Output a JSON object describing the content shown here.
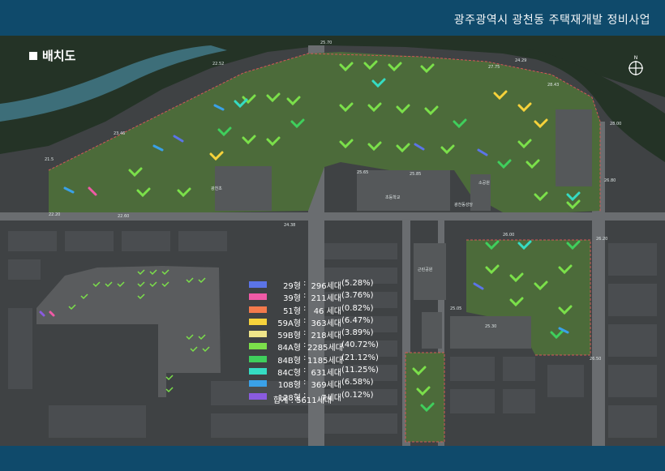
{
  "header": {
    "title": "광주광역시 광천동 주택재개발 정비사업"
  },
  "section": {
    "title": "배치도"
  },
  "compass": {
    "label": "N"
  },
  "legend": {
    "rows": [
      {
        "type": "29형",
        "sep": ":",
        "units": "296세대",
        "pct": "(5.28%)",
        "color": "#5b74e8"
      },
      {
        "type": "39형",
        "sep": ":",
        "units": "211세대",
        "pct": "(3.76%)",
        "color": "#f05aa6"
      },
      {
        "type": "51형",
        "sep": ":",
        "units": "46 세대",
        "pct": "(0.82%)",
        "color": "#f47a4c"
      },
      {
        "type": "59A형",
        "sep": ":",
        "units": "363세대",
        "pct": "(6.47%)",
        "color": "#f6d23b"
      },
      {
        "type": "59B형",
        "sep": ":",
        "units": "218세대",
        "pct": "(3.89%)",
        "color": "#f0e58a"
      },
      {
        "type": "84A형",
        "sep": ":",
        "units": "2285세대",
        "pct": "(40.72%)",
        "color": "#7be04a"
      },
      {
        "type": "84B형",
        "sep": ":",
        "units": "1185세대",
        "pct": "(21.12%)",
        "color": "#3fcf5c"
      },
      {
        "type": "84C형",
        "sep": ":",
        "units": "631세대",
        "pct": "(11.25%)",
        "color": "#35dcc3"
      },
      {
        "type": "108형",
        "sep": ":",
        "units": "369세대",
        "pct": "(6.58%)",
        "color": "#3aa1e8"
      },
      {
        "type": "128형",
        "sep": ":",
        "units": "7세대",
        "pct": "(0.12%)",
        "color": "#8a5be0"
      }
    ],
    "total": "합계 : 5611세대"
  },
  "map_labels": {
    "school1": "광천초",
    "school2": "초등학교",
    "park1": "근린공원",
    "church": "광천동성당",
    "facility": "소공원",
    "elevations": [
      "25.70",
      "22.52",
      "23.46",
      "21.5",
      "22.20",
      "22.60",
      "24.38",
      "25.65",
      "25.85",
      "26.00",
      "28.43",
      "27.75",
      "24.29",
      "25.05",
      "25.30",
      "26.50",
      "26.20",
      "26.80",
      "28.00"
    ]
  }
}
